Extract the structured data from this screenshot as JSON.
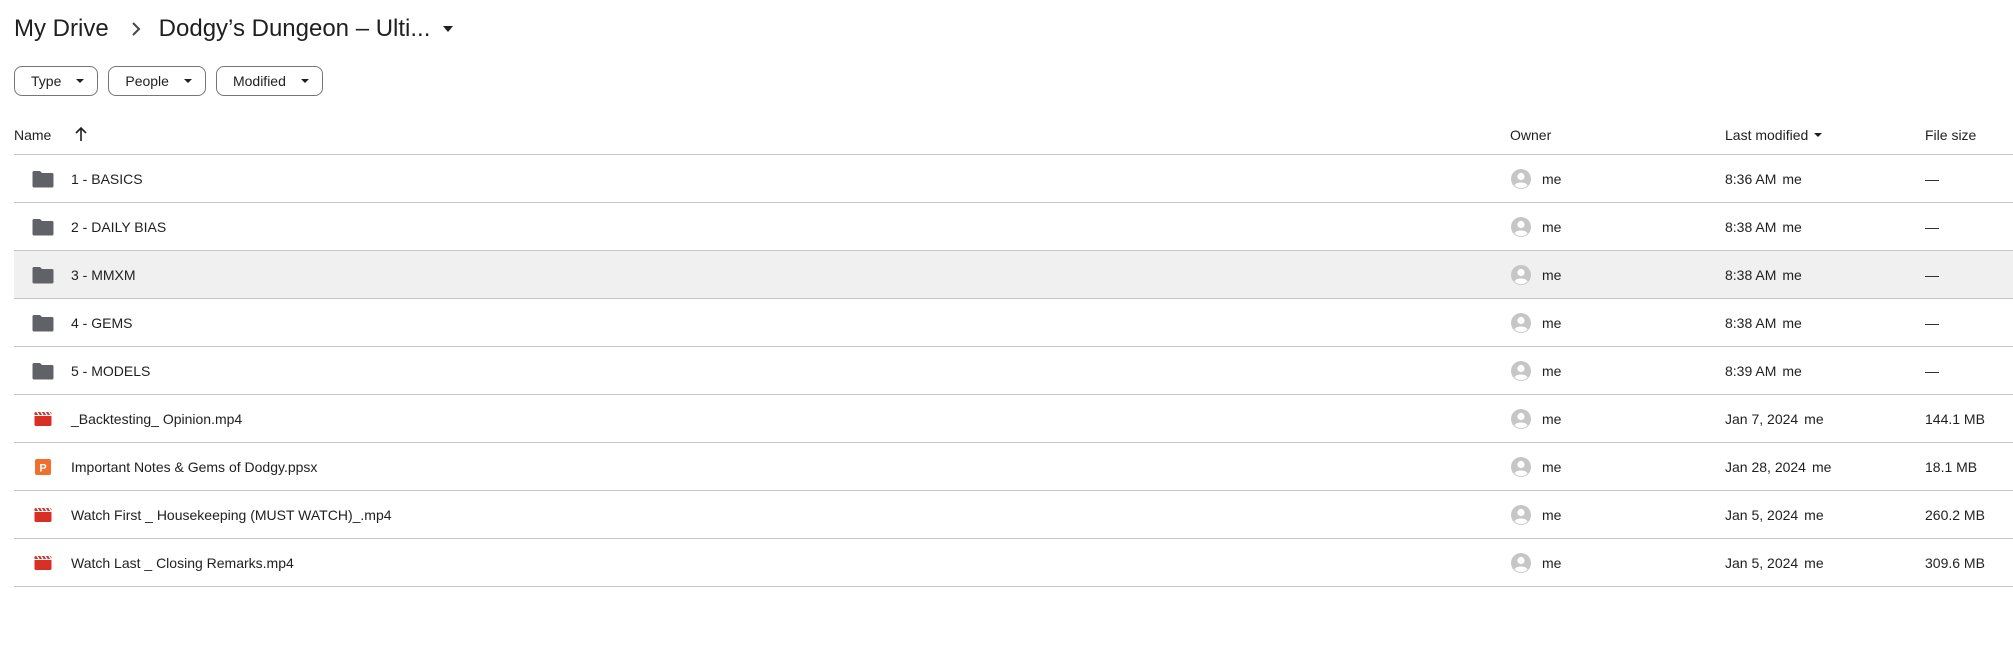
{
  "breadcrumb": {
    "root": "My Drive",
    "current": "Dodgy’s Dungeon – Ulti..."
  },
  "filters": [
    {
      "label": "Type"
    },
    {
      "label": "People"
    },
    {
      "label": "Modified"
    }
  ],
  "columns": {
    "name": "Name",
    "owner": "Owner",
    "last_modified": "Last modified",
    "file_size": "File size"
  },
  "files": [
    {
      "icon": "folder-icon",
      "name": "1 - BASICS",
      "owner": "me",
      "modified": "8:36 AM",
      "modified_by": "me",
      "size": "—"
    },
    {
      "icon": "folder-icon",
      "name": "2 - DAILY BIAS",
      "owner": "me",
      "modified": "8:38 AM",
      "modified_by": "me",
      "size": "—"
    },
    {
      "icon": "folder-icon",
      "name": "3  - MMXM",
      "owner": "me",
      "modified": "8:38 AM",
      "modified_by": "me",
      "size": "—"
    },
    {
      "icon": "folder-icon",
      "name": "4 - GEMS",
      "owner": "me",
      "modified": "8:38 AM",
      "modified_by": "me",
      "size": "—"
    },
    {
      "icon": "folder-icon",
      "name": "5 - MODELS",
      "owner": "me",
      "modified": "8:39 AM",
      "modified_by": "me",
      "size": "—"
    },
    {
      "icon": "video-file-icon",
      "name": "_Backtesting_ Opinion.mp4",
      "owner": "me",
      "modified": "Jan 7, 2024",
      "modified_by": "me",
      "size": "144.1 MB"
    },
    {
      "icon": "slides-file-icon",
      "name": "Important Notes & Gems of Dodgy.ppsx",
      "owner": "me",
      "modified": "Jan 28, 2024",
      "modified_by": "me",
      "size": "18.1 MB"
    },
    {
      "icon": "video-file-icon",
      "name": "Watch First _ Housekeeping (MUST WATCH)_.mp4",
      "owner": "me",
      "modified": "Jan 5, 2024",
      "modified_by": "me",
      "size": "260.2 MB"
    },
    {
      "icon": "video-file-icon",
      "name": "Watch Last _ Closing Remarks.mp4",
      "owner": "me",
      "modified": "Jan 5, 2024",
      "modified_by": "me",
      "size": "309.6 MB"
    }
  ],
  "colors": {
    "folder": "#5f6368",
    "video": "#d93025",
    "slides": "#f26e2c",
    "avatar": "#c4c7c5",
    "selected_row": "#f0f0f0"
  }
}
